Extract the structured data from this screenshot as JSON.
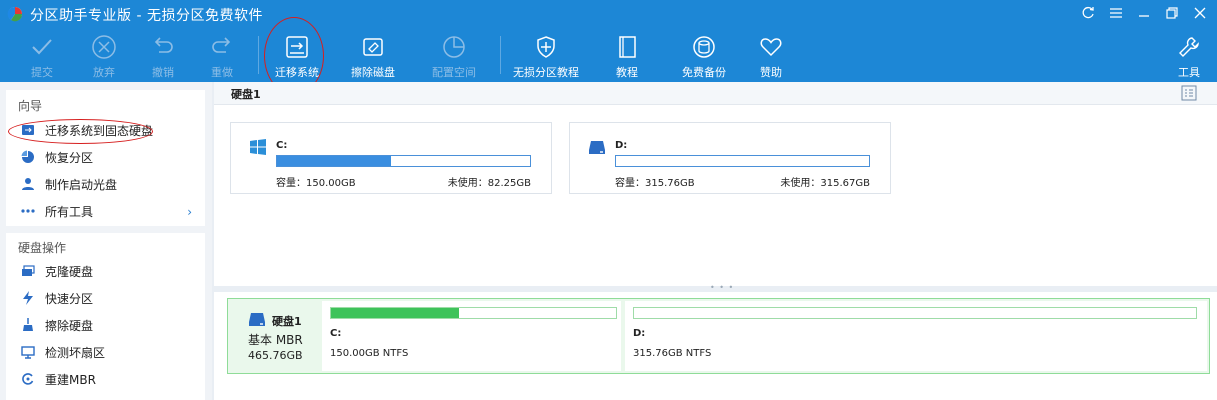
{
  "window": {
    "title": "分区助手专业版 - 无损分区免费软件"
  },
  "toolbar": {
    "items": [
      {
        "label": "提交"
      },
      {
        "label": "放弃"
      },
      {
        "label": "撤销"
      },
      {
        "label": "重做"
      },
      {
        "label": "迁移系统"
      },
      {
        "label": "擦除磁盘"
      },
      {
        "label": "配置空间"
      },
      {
        "label": "无损分区教程"
      },
      {
        "label": "教程"
      },
      {
        "label": "免费备份"
      },
      {
        "label": "赞助"
      },
      {
        "label": "工具"
      }
    ]
  },
  "sidebar": {
    "wizard": {
      "title": "向导",
      "items": [
        {
          "label": "迁移系统到固态硬盘"
        },
        {
          "label": "恢复分区"
        },
        {
          "label": "制作启动光盘"
        },
        {
          "label": "所有工具"
        }
      ]
    },
    "disk_ops": {
      "title": "硬盘操作",
      "items": [
        {
          "label": "克隆硬盘"
        },
        {
          "label": "快速分区"
        },
        {
          "label": "擦除硬盘"
        },
        {
          "label": "检测坏扇区"
        },
        {
          "label": "重建MBR"
        }
      ]
    }
  },
  "disk_view": {
    "header": "硬盘1",
    "partitions": [
      {
        "letter": "C:",
        "capacity": "容量：150.00GB",
        "free": "未使用：82.25GB",
        "used_fraction": 0.45
      },
      {
        "letter": "D:",
        "capacity": "容量：315.76GB",
        "free": "未使用：315.67GB",
        "used_fraction": 0.0
      }
    ]
  },
  "disk_map": {
    "name": "硬盘1",
    "type": "基本 MBR",
    "size": "465.76GB",
    "partitions": [
      {
        "letter": "C:",
        "desc": "150.00GB NTFS",
        "used_fraction": 0.45
      },
      {
        "letter": "D:",
        "desc": "315.76GB NTFS",
        "used_fraction": 0.0
      }
    ]
  },
  "colors": {
    "accent": "#1d87d6",
    "disk_used": "#3a8ee0",
    "partition_used": "#3ec35a",
    "annotation": "#d61f1f"
  }
}
